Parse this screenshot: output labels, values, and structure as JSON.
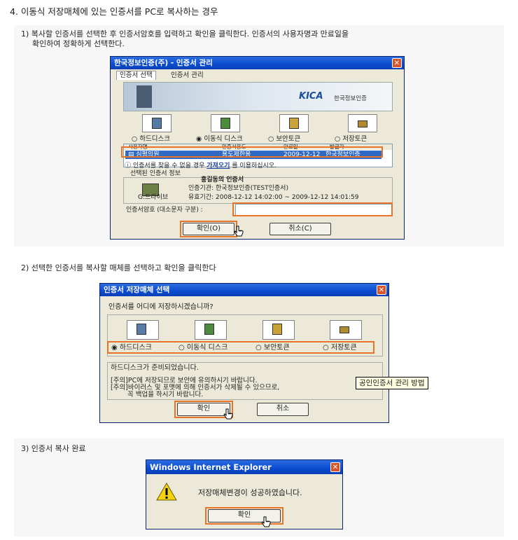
{
  "heading": "4. 이동식 저장매체에 있는 인증서를 PC로 복사하는 경우",
  "step1": {
    "line1": "1) 복사할 인증서를 선택한 후 인증서암호를 입력하고 확인을 클릭한다. 인증서의 사용자명과 만료일을",
    "line2": "확인하여 정확하게 선택한다."
  },
  "dialog1": {
    "title": "한국정보인증(주) - 인증서 관리",
    "tab1": "인증서 선택",
    "tab2": "인증서 관리",
    "logo": "KICA",
    "logo_sub": "한국정보인증",
    "media": [
      "하드디스크",
      "이동식 디스크",
      "보안토큰",
      "저장토큰"
    ],
    "columns": [
      "사용자명",
      "인증서용도",
      "만료일",
      "발급자"
    ],
    "row": [
      "심평의원",
      "용도제한용",
      "2009-12-12",
      "한국정보인증"
    ],
    "notice_a": "인증서를 찾을 수 없을 경우",
    "notice_link": "가져오기",
    "notice_b": "를 이용하십시오.",
    "selected_info": "선택된 인증서 정보",
    "cert_name": "홍길동의 인증서",
    "issuer": "인증기관: 한국정보인증(TEST인증서)",
    "drive": "G:드라이브",
    "validity": "유효기간: 2008-12-12 14:02:00 ~ 2009-12-12 14:01:59",
    "password_label": "인증서암호 (대소문자 구분) :",
    "ok": "확인(O)",
    "cancel": "취소(C)"
  },
  "step2": "2) 선택한 인증서를 복사할 매체를 선택하고 확인을 클릭한다",
  "dialog2": {
    "title": "인증서 저장매체 선택",
    "question": "인증서를 어디에 저장하시겠습니까?",
    "media": [
      "하드디스크",
      "이동식 디스크",
      "보안토큰",
      "저장토큰"
    ],
    "status1": "하드디스크가 준비되었습니다.",
    "status2": "[주의]PC에 저장되므로 보안에 유의하시기 바랍니다.",
    "status3": "[주의]바이러스 및 포맷에 의해 인증서가 삭제될 수 있으므로,",
    "status4": "꼭 백업을 하시기 바랍니다.",
    "tooltip": "공인인증서 관리 방법",
    "ok": "확인",
    "cancel": "취소"
  },
  "step3": "3) 인증서 복사 완료",
  "dialog3": {
    "title": "Windows Internet Explorer",
    "message": "저장매체변경이 성공하였습니다.",
    "ok": "확인"
  },
  "colors": {
    "accent": "#e8742a",
    "titlebar": "#0b4bd0",
    "selection": "#316ac5"
  }
}
